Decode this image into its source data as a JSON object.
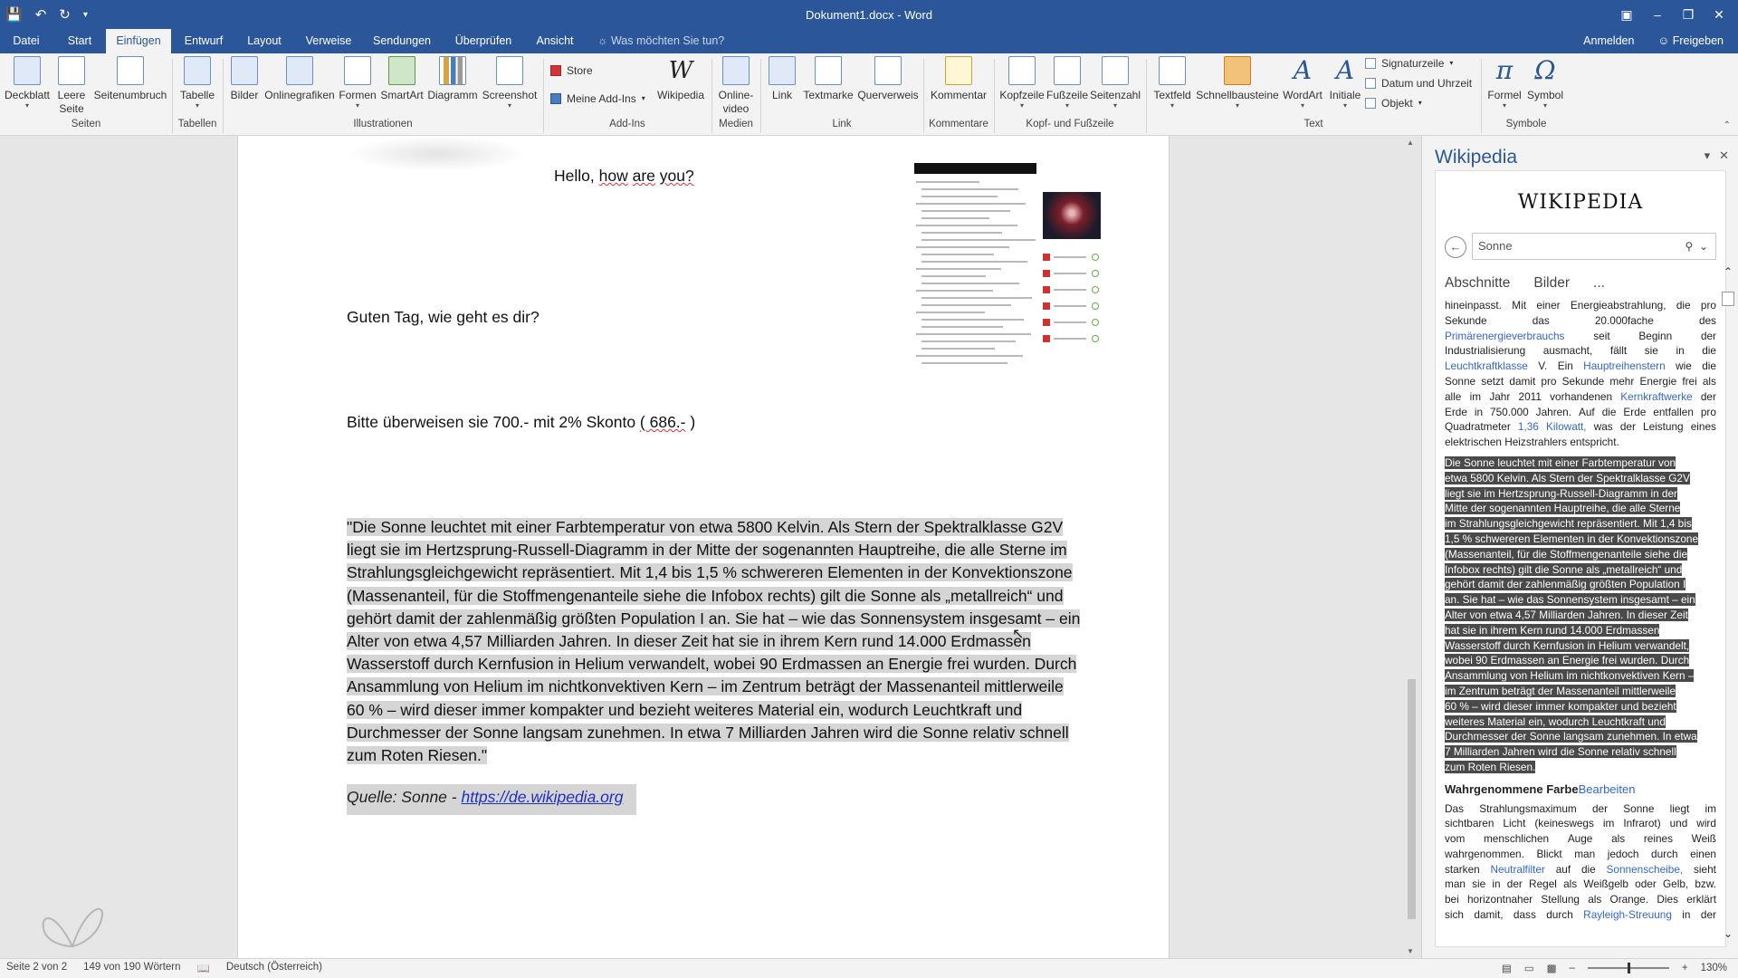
{
  "titlebar": {
    "title": "Dokument1.docx - Word",
    "qat": [
      "save-icon",
      "undo-icon",
      "redo-icon",
      "customize-icon"
    ]
  },
  "tabs": [
    "Datei",
    "Start",
    "Einfügen",
    "Entwurf",
    "Layout",
    "Verweise",
    "Sendungen",
    "Überprüfen",
    "Ansicht"
  ],
  "active_tab": "Einfügen",
  "tell_me": "Was möchten Sie tun?",
  "account": {
    "signin": "Anmelden",
    "share": "Freigeben"
  },
  "ribbon": {
    "deckblatt": "Deckblatt",
    "leere_seite_1": "Leere",
    "leere_seite_2": "Seite",
    "seitenumbruch": "Seitenumbruch",
    "tabelle": "Tabelle",
    "bilder": "Bilder",
    "onlinegrafiken": "Onlinegrafiken",
    "formen": "Formen",
    "smartart": "SmartArt",
    "diagramm": "Diagramm",
    "screenshot": "Screenshot",
    "store": "Store",
    "meine_addins": "Meine Add-Ins",
    "wikipedia": "Wikipedia",
    "onlinevideo_1": "Online-",
    "onlinevideo_2": "video",
    "link": "Link",
    "textmarke": "Textmarke",
    "querverweis": "Querverweis",
    "kommentar": "Kommentar",
    "kopfzeile": "Kopfzeile",
    "fusszeile": "Fußzeile",
    "seitenzahl": "Seitenzahl",
    "textfeld": "Textfeld",
    "schnellbausteine": "Schnellbausteine",
    "wordart": "WordArt",
    "initiale": "Initiale",
    "signaturzeile": "Signaturzeile",
    "datum_uhrzeit": "Datum und Uhrzeit",
    "objekt": "Objekt",
    "formel": "Formel",
    "symbol": "Symbol",
    "groups": {
      "seiten": "Seiten",
      "tabellen": "Tabellen",
      "illustrationen": "Illustrationen",
      "addins": "Add-Ins",
      "medien": "Medien",
      "link": "Link",
      "kommentare": "Kommentare",
      "kopf_fuss": "Kopf- und Fußzeile",
      "text": "Text",
      "symbole": "Symbole"
    }
  },
  "document": {
    "line1_a": "Hello, ",
    "line1_b": "how",
    "line1_c": " ",
    "line1_d": "are",
    "line1_e": " ",
    "line1_f": "you?",
    "line2": "Guten Tag, wie geht es dir?",
    "line3_a": "Bitte überweisen sie 700.- mit 2% Skonto ",
    "line3_b": "( 686.-",
    "line3_c": " )",
    "quote_lines": [
      "\"Die Sonne leuchtet mit einer Farbtemperatur von etwa 5800 Kelvin. Als Stern der Spektralklasse G2V",
      "liegt sie im Hertzsprung-Russell-Diagramm in der Mitte der sogenannten Hauptreihe, die alle Sterne im",
      "Strahlungsgleichgewicht repräsentiert. Mit 1,4 bis 1,5 % schwereren Elementen in der Konvektionszone",
      "(Massenanteil, für die Stoffmengenanteile siehe die Infobox rechts) gilt die Sonne als „metallreich“ und",
      "gehört damit der zahlenmäßig größten Population I an. Sie hat – wie das Sonnensystem insgesamt – ein",
      "Alter von etwa 4,57 Milliarden Jahren. In dieser Zeit hat sie in ihrem Kern rund 14.000 Erdmassen",
      "Wasserstoff durch Kernfusion in Helium verwandelt, wobei 90 Erdmassen an Energie frei wurden. Durch",
      "Ansammlung von Helium im nichtkonvektiven Kern – im Zentrum beträgt der Massenanteil mittlerweile",
      "60 % – wird dieser immer kompakter und bezieht weiteres Material ein, wodurch Leuchtkraft und",
      "Durchmesser der Sonne langsam zunehmen. In etwa 7 Milliarden Jahren wird die Sonne relativ schnell",
      "zum Roten Riesen.\""
    ],
    "source_label": "Quelle: Sonne - ",
    "source_link": "https://de.wikipedia.org"
  },
  "wiki": {
    "pane_title": "Wikipedia",
    "logo": "WIKIPEDIA",
    "search_value": "Sonne",
    "tabs": [
      "Abschnitte",
      "Bilder",
      "..."
    ],
    "p1": [
      [
        "hineinpasst.",
        "Mit",
        "einer",
        "Energieabstrahlung,",
        "die",
        "pro"
      ],
      [
        "Sekunde",
        "das",
        "20.000fache",
        "des"
      ],
      [
        "Primärenergieverbrauchs",
        "seit",
        "Beginn",
        "der"
      ],
      [
        "Industrialisierung",
        "ausmacht,",
        "fällt",
        "sie",
        "in",
        "die"
      ],
      [
        "Leuchtkraftklasse",
        "V.",
        "Ein",
        "Hauptreihenstern",
        "wie",
        "die"
      ],
      [
        "Sonne",
        "setzt",
        "damit",
        "pro",
        "Sekunde",
        "mehr",
        "Energie",
        "frei",
        "als"
      ],
      [
        "alle",
        "im",
        "Jahr",
        "2011",
        "vorhandenen",
        "Kernkraftwerke",
        "der"
      ],
      [
        "Erde",
        "in",
        "750.000",
        "Jahren.",
        "Auf",
        "die",
        "Erde",
        "entfallen",
        "pro"
      ],
      [
        "Quadratmeter",
        "1,36",
        "Kilowatt,",
        "was",
        "der",
        "Leistung",
        "eines"
      ],
      [
        "elektrischen Heizstrahlers entspricht."
      ]
    ],
    "p2": [
      "Die Sonne leuchtet mit einer Farbtemperatur von",
      "etwa 5800 Kelvin. Als Stern der Spektralklasse G2V",
      "liegt sie im Hertzsprung-Russell-Diagramm in der",
      "Mitte der sogenannten Hauptreihe, die alle Sterne",
      "im Strahlungsgleichgewicht repräsentiert. Mit 1,4 bis",
      "1,5 % schwereren Elementen in der Konvektionszone",
      "(Massenanteil, für die Stoffmengenanteile siehe die",
      "Infobox rechts) gilt die Sonne als „metallreich“ und",
      "gehört damit der zahlenmäßig größten Population I",
      "an. Sie hat – wie das Sonnensystem insgesamt – ein",
      "Alter von etwa 4,57 Milliarden Jahren. In dieser Zeit",
      "hat sie in ihrem Kern rund 14.000 Erdmassen",
      "Wasserstoff durch Kernfusion in Helium verwandelt,",
      "wobei 90 Erdmassen an Energie frei wurden. Durch",
      "Ansammlung von Helium im nichtkonvektiven Kern –",
      "im Zentrum beträgt der Massenanteil mittlerweile",
      "60 % – wird dieser immer kompakter und bezieht",
      "weiteres Material ein, wodurch Leuchtkraft und",
      "Durchmesser der Sonne langsam zunehmen. In etwa",
      "7 Milliarden Jahren wird die Sonne relativ schnell",
      "zum Roten Riesen."
    ],
    "heading": "Wahrgenommene Farbe",
    "heading_edit": "Bearbeiten",
    "p3": [
      [
        "Das",
        "Strahlungsmaximum",
        "der",
        "Sonne",
        "liegt",
        "im"
      ],
      [
        "sichtbaren",
        "Licht",
        "(keineswegs",
        "im",
        "Infrarot)",
        "und",
        "wird"
      ],
      [
        "vom",
        "menschlichen",
        "Auge",
        "als",
        "reines",
        "Weiß"
      ],
      [
        "wahrgenommen.",
        "Blickt",
        "man",
        "jedoch",
        "durch",
        "einen"
      ],
      [
        "starken",
        "Neutralfilter",
        "auf",
        "die",
        "Sonnenscheibe,",
        "sieht"
      ],
      [
        "man",
        "sie",
        "in",
        "der",
        "Regel",
        "als",
        "Weißgelb",
        "oder",
        "Gelb,",
        "bzw."
      ],
      [
        "bei",
        "horizontnaher",
        "Stellung",
        "als",
        "Orange.",
        "Dies",
        "erklärt"
      ],
      [
        "sich",
        "damit,",
        "dass",
        "durch",
        "Rayleigh-Streuung",
        "in",
        "der"
      ]
    ]
  },
  "status": {
    "page": "Seite 2 von 2",
    "words": "149 von 190 Wörtern",
    "language": "Deutsch (Österreich)",
    "zoom": "130%"
  }
}
